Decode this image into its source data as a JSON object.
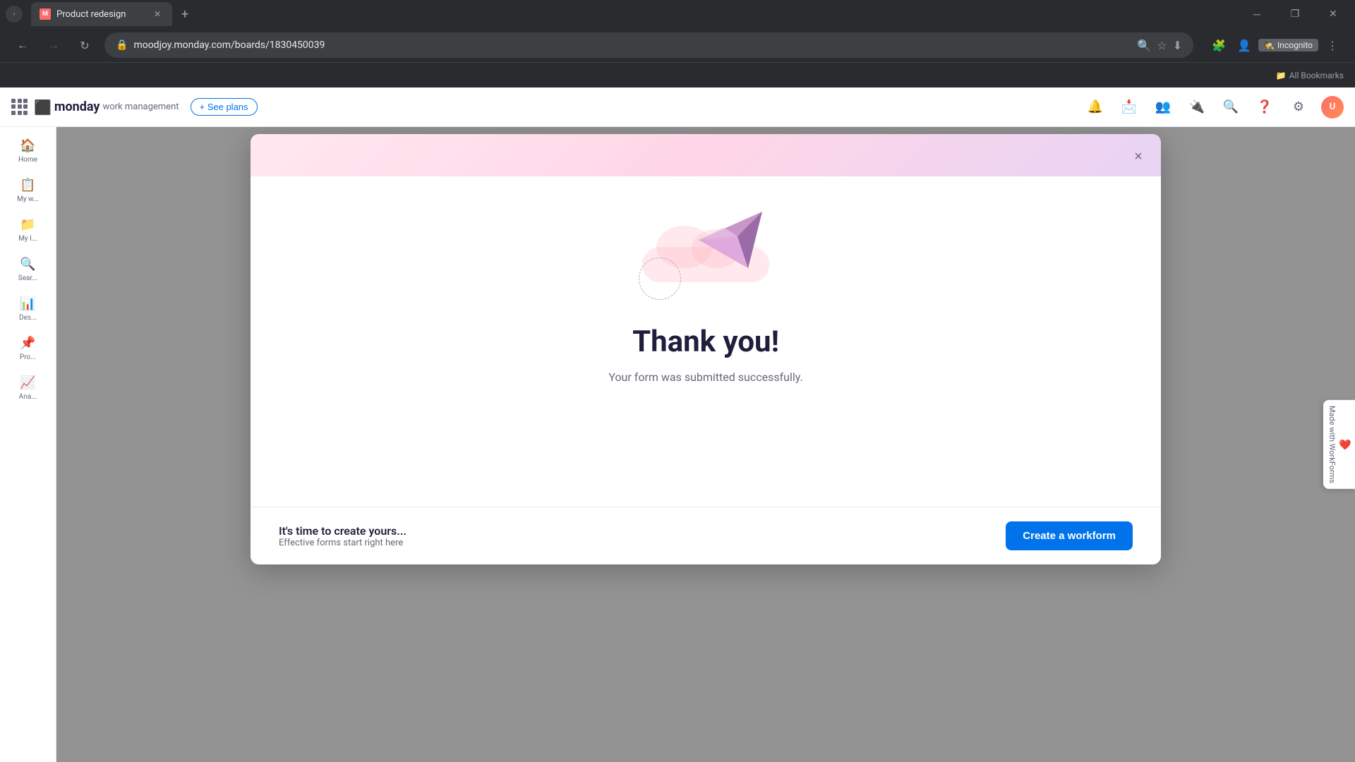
{
  "browser": {
    "tab_title": "Product redesign",
    "tab_favicon": "M",
    "url": "moodjoy.monday.com/boards/1830450039",
    "new_tab_label": "+",
    "incognito_label": "Incognito",
    "bookmarks_label": "All Bookmarks"
  },
  "topbar": {
    "app_name": "monday",
    "app_type": "work management",
    "see_plans_label": "+ See plans",
    "avatar_initials": "U"
  },
  "sidebar": {
    "items": [
      {
        "label": "Home",
        "icon": "🏠"
      },
      {
        "label": "My w...",
        "icon": "📋"
      },
      {
        "label": "My I...",
        "icon": "📁"
      },
      {
        "label": "Sear...",
        "icon": "🔍"
      },
      {
        "label": "Des...",
        "icon": "📊"
      },
      {
        "label": "Pro...",
        "icon": "📌"
      },
      {
        "label": "Ana...",
        "icon": "📈"
      }
    ]
  },
  "modal": {
    "close_label": "×",
    "thank_you_heading": "Thank you!",
    "submitted_text": "Your form was submitted successfully.",
    "cta_heading": "It's time to create yours...",
    "cta_subtext": "Effective forms start right here",
    "cta_button_label": "Create a workform"
  },
  "workforms_badge": {
    "label": "Made with WorkForms"
  }
}
